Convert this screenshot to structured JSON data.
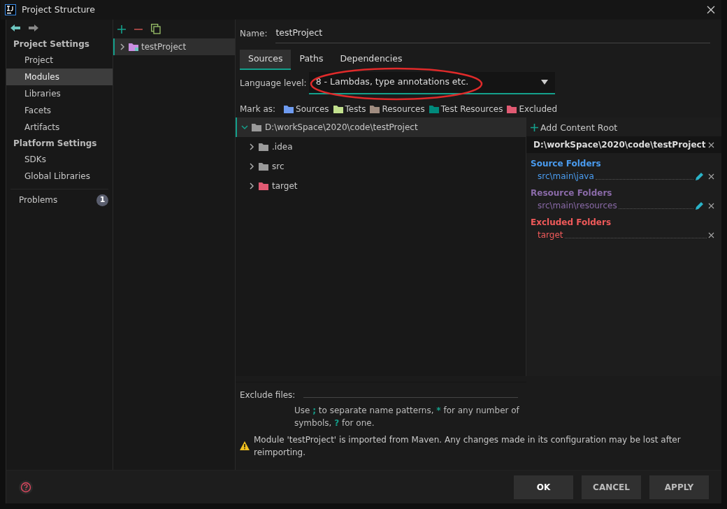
{
  "window": {
    "title": "Project Structure"
  },
  "nav": {
    "sections": [
      {
        "heading": "Project Settings",
        "items": [
          {
            "label": "Project",
            "selected": false
          },
          {
            "label": "Modules",
            "selected": true
          },
          {
            "label": "Libraries",
            "selected": false
          },
          {
            "label": "Facets",
            "selected": false
          },
          {
            "label": "Artifacts",
            "selected": false
          }
        ]
      },
      {
        "heading": "Platform Settings",
        "items": [
          {
            "label": "SDKs",
            "selected": false
          },
          {
            "label": "Global Libraries",
            "selected": false
          }
        ]
      }
    ],
    "problems": {
      "label": "Problems",
      "count": "1"
    }
  },
  "modules": [
    {
      "label": "testProject",
      "selected": true
    }
  ],
  "name": {
    "label": "Name:",
    "value": "testProject"
  },
  "tabs": [
    {
      "label": "Sources",
      "selected": true
    },
    {
      "label": "Paths",
      "selected": false
    },
    {
      "label": "Dependencies",
      "selected": false
    }
  ],
  "language_level": {
    "label": "Language level:",
    "value": "8 - Lambdas, type annotations etc.",
    "highlighted": true
  },
  "mark_as": {
    "label": "Mark as:",
    "items": [
      {
        "label": "Sources",
        "color": "#6e9bf0"
      },
      {
        "label": "Tests",
        "color": "#c2e08e"
      },
      {
        "label": "Resources",
        "color": "#a08c80"
      },
      {
        "label": "Test Resources",
        "color": "#00897b"
      },
      {
        "label": "Excluded",
        "color": "#e05a72"
      }
    ]
  },
  "tree": {
    "label": "D:\\workSpace\\2020\\code\\testProject",
    "expanded": true,
    "selected": true,
    "children": [
      {
        "label": ".idea",
        "expanded": false,
        "selected": false,
        "color": "#9a9a9a"
      },
      {
        "label": "src",
        "expanded": false,
        "selected": false,
        "color": "#9a9a9a"
      },
      {
        "label": "target",
        "expanded": false,
        "selected": false,
        "color": "#e05a72"
      }
    ]
  },
  "content_root": {
    "add_label": "Add Content Root",
    "path": "D:\\workSpace\\2020\\code\\testProject",
    "groups": [
      {
        "title": "Source Folders",
        "color": "#4a9cf0",
        "folders": [
          {
            "path": "src\\main\\java",
            "editable": true
          }
        ]
      },
      {
        "title": "Resource Folders",
        "color": "#8a6aa8",
        "folders": [
          {
            "path": "src\\main\\resources",
            "editable": true
          }
        ]
      },
      {
        "title": "Excluded Folders",
        "color": "#f05a5a",
        "folders": [
          {
            "path": "target",
            "editable": false
          }
        ]
      }
    ]
  },
  "exclude_files": {
    "label": "Exclude files:",
    "hint": "Use **;** to separate name patterns, ***** for any number of symbols, **?** for one."
  },
  "warning": "Module 'testProject' is imported from Maven. Any changes made in its configuration may be lost after reimporting.",
  "buttons": [
    {
      "label": "OK",
      "default": true
    },
    {
      "label": "CANCEL",
      "default": false
    },
    {
      "label": "APPLY",
      "default": false
    }
  ]
}
